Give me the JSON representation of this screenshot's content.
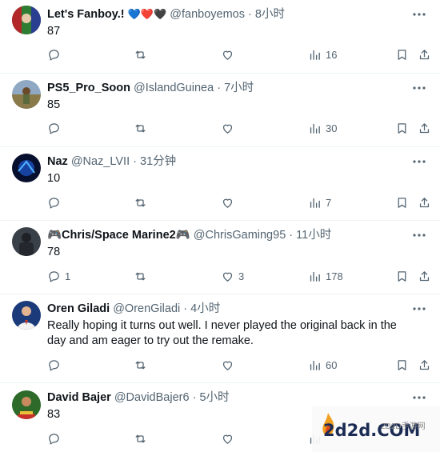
{
  "tweets": [
    {
      "name": "Let's Fanboy.!",
      "name_emojis": "💙❤️🖤",
      "handle": "@fanboyemos",
      "time": "8小时",
      "text": "87",
      "replies": "",
      "likes": "",
      "views": "16"
    },
    {
      "name": "PS5_Pro_Soon",
      "handle": "@IslandGuinea",
      "time": "7小时",
      "text": "85",
      "replies": "",
      "likes": "",
      "views": "30"
    },
    {
      "name": "Naz",
      "handle": "@Naz_LVII",
      "time": "31分钟",
      "text": "10",
      "replies": "",
      "likes": "",
      "views": "7"
    },
    {
      "name": "🎮Chris/Space Marine2🎮",
      "handle": "@ChrisGaming95",
      "time": "11小时",
      "text": "78",
      "replies": "1",
      "likes": "3",
      "views": "178"
    },
    {
      "name": "Oren Giladi",
      "handle": "@OrenGiladi",
      "time": "4小时",
      "text": "Really hoping it turns out well. I never played the original back in the day and am eager to try out the remake.",
      "replies": "",
      "likes": "",
      "views": "60"
    },
    {
      "name": "David Bajer",
      "handle": "@DavidBajer6",
      "time": "5小时",
      "text": "83",
      "replies": "",
      "likes": "",
      "views": ""
    }
  ],
  "separator": "·",
  "watermark": {
    "logo": "2d2d.COM",
    "site": "2D2D手游网"
  },
  "colors": {
    "text": "#0f1419",
    "secondary": "#536471",
    "border": "#eff3f4"
  },
  "icons": {
    "reply": "reply-icon",
    "repost": "repost-icon",
    "like": "like-icon",
    "views": "views-icon",
    "bookmark": "bookmark-icon",
    "share": "share-icon",
    "more": "more-icon"
  }
}
